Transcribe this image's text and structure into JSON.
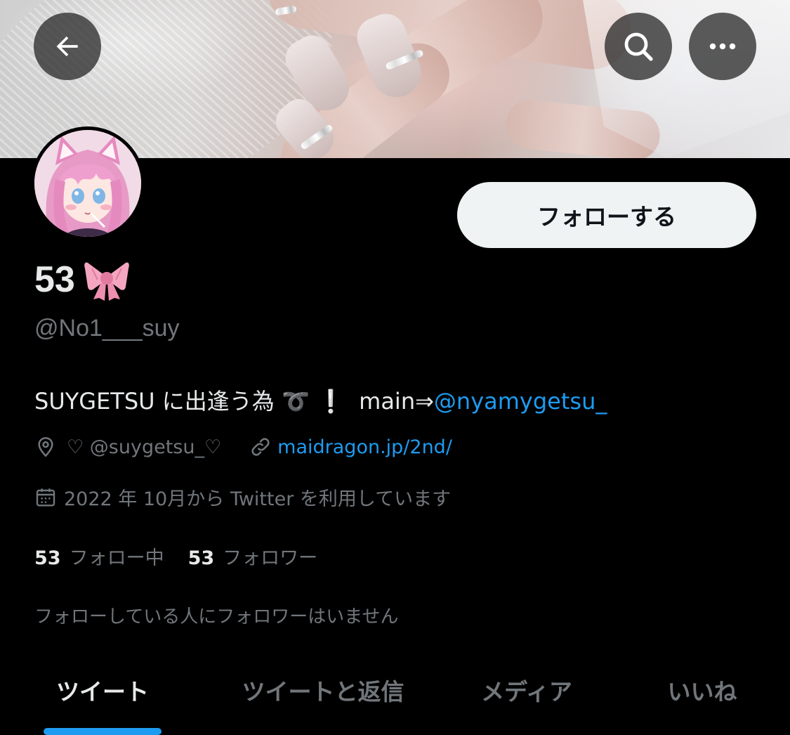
{
  "header": {
    "back_icon": "arrow-left-icon",
    "search_icon": "search-icon",
    "more_icon": "more-horizontal-icon"
  },
  "profile": {
    "follow_label": "フォローする",
    "display_name": "53",
    "display_emoji": "ribbon-emoji",
    "handle": "@No1___suy",
    "bio": {
      "text": "SUYGETSU に出逢う為",
      "swirl": "➰",
      "exclaim": "❕",
      "main_prefix": "main⇒",
      "main_link": "@nyamygetsu_"
    },
    "location": "♡ @suygetsu_♡",
    "website": "maidragon.jp/2nd/",
    "joined": "2022 年 10月から Twitter を利用しています",
    "following_count": "53",
    "following_label": "フォロー中",
    "followers_count": "53",
    "followers_label": "フォロワー",
    "no_mutuals": "フォローしている人にフォロワーはいません"
  },
  "tabs": [
    {
      "label": "ツイート",
      "active": true
    },
    {
      "label": "ツイートと返信",
      "active": false
    },
    {
      "label": "メディア",
      "active": false
    },
    {
      "label": "いいね",
      "active": false
    }
  ],
  "colors": {
    "accent": "#1d9bf0",
    "background": "#000000",
    "text_primary": "#e7e9ea",
    "text_secondary": "#71767b"
  }
}
